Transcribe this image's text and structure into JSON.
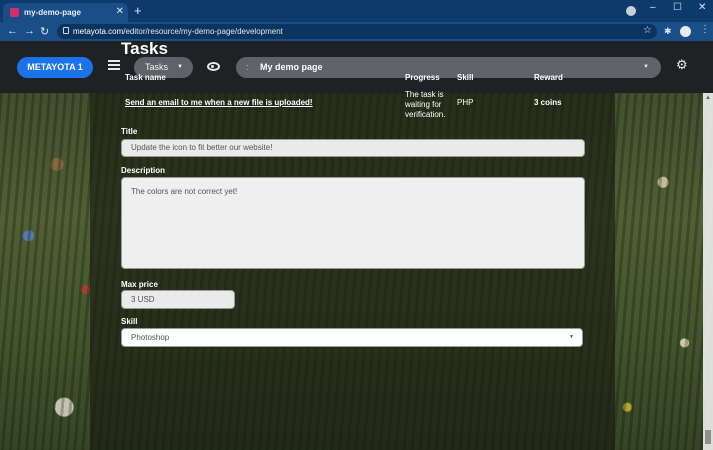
{
  "browser": {
    "tab_title": "my-demo-page",
    "tab_close": "✕",
    "new_tab": "+",
    "url_host": "metayota.com",
    "url_path": "/editor/resource/my-demo-page/development",
    "window_min": "–",
    "window_max": "☐",
    "window_close": "✕"
  },
  "header": {
    "brand": "METAYOTA 1",
    "section_select": "Tasks",
    "page_select": "My demo page",
    "page_handle": ":"
  },
  "tasks": {
    "heading": "Tasks",
    "columns": {
      "task_name": "Task name",
      "progress": "Progress",
      "skill": "Skill",
      "reward": "Reward"
    },
    "row": {
      "task_name": "Send an email to me when a new file is uploaded!",
      "progress": "The task is waiting for verification.",
      "skill": "PHP",
      "reward": "3 coins"
    }
  },
  "form": {
    "title_label": "Title",
    "title_value": "Update the icon to fit better our website!",
    "description_label": "Description",
    "description_value": "The colors are not correct yet!",
    "max_price_label": "Max price",
    "max_price_value": "3 USD",
    "skill_label": "Skill",
    "skill_value": "Photoshop"
  }
}
